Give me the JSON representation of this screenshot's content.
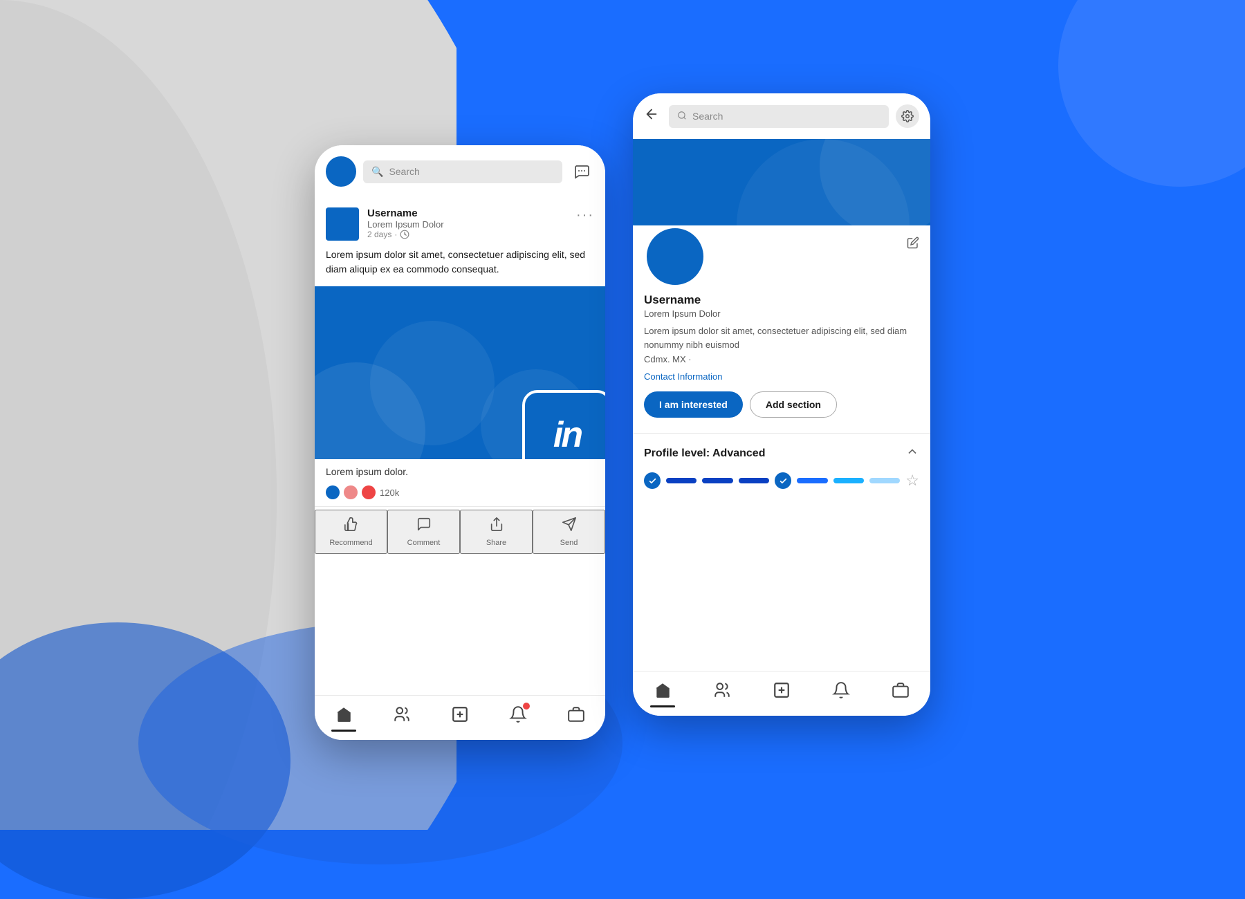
{
  "background": {
    "color": "#1a6dff"
  },
  "left_phone": {
    "header": {
      "search_placeholder": "Search",
      "message_icon": "💬"
    },
    "post": {
      "username": "Username",
      "subtitle": "Lorem Ipsum Dolor",
      "time": "2 days",
      "menu": "···",
      "text": "Lorem ipsum dolor sit amet, consectetuer adipiscing elit, sed diam aliquip ex ea commodo consequat.",
      "footer_text": "Lorem ipsum dolor.",
      "reaction_count": "120k",
      "actions": [
        {
          "label": "Recommend"
        },
        {
          "label": "Comment"
        },
        {
          "label": "Share"
        },
        {
          "label": "Send"
        }
      ]
    },
    "nav_items": [
      "home",
      "people",
      "add",
      "bell",
      "briefcase"
    ]
  },
  "right_phone": {
    "header": {
      "search_placeholder": "Search"
    },
    "profile": {
      "name": "Username",
      "subtitle": "Lorem Ipsum Dolor",
      "bio": "Lorem ipsum dolor sit amet, consectetuer adipiscing elit, sed diam nonummy nibh euismod",
      "location": "Cdmx. MX ·",
      "contact_link": "Contact Information",
      "interested_label": "I am interested",
      "add_section_label": "Add section",
      "level_title": "Profile level: Advanced",
      "edit_icon": "✏️"
    },
    "nav_items": [
      "home",
      "people",
      "add",
      "bell",
      "briefcase"
    ]
  },
  "linkedin_logo": "in"
}
